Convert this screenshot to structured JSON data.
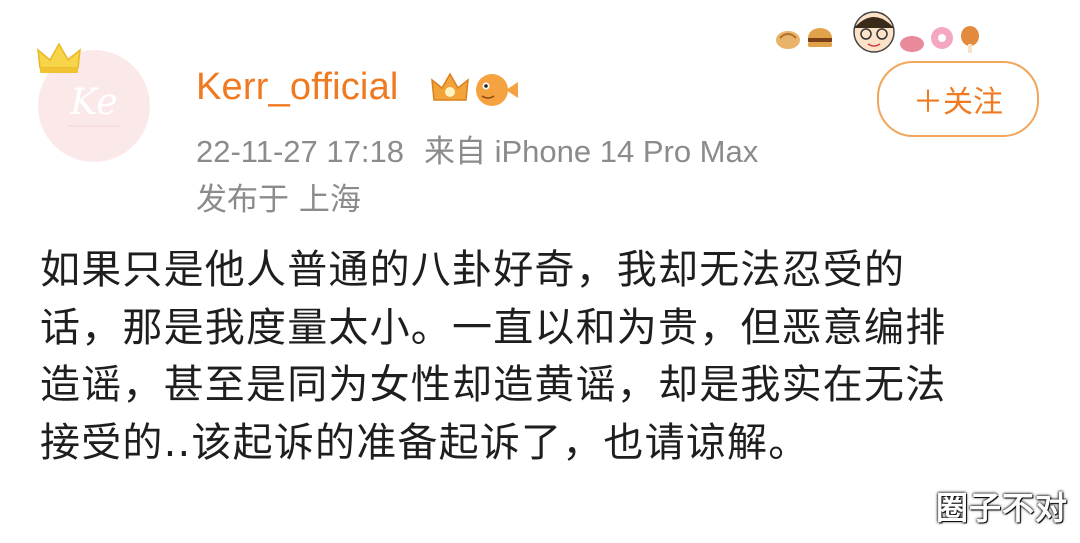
{
  "header": {
    "username": "Kerr_official",
    "follow_label": "＋关注",
    "time": "22-11-27 17:18",
    "source": "来自 iPhone 14 Pro Max",
    "location": "发布于 上海"
  },
  "avatar": {
    "monogram": "Ke"
  },
  "post": {
    "lines": [
      "如果只是他人普通的八卦好奇，我却无法忍受的",
      "话，那是我度量太小。一直以和为贵，但恶意编排",
      "造谣，甚至是同为女性却造黄谣，却是我实在无法",
      "接受的..该起诉的准备起诉了，也请谅解。"
    ]
  },
  "watermark": "圈子不对",
  "colors": {
    "accent": "#f07a22",
    "follow_border": "#f2a65a",
    "meta": "#8b8b8b",
    "text": "#1e1e1e"
  },
  "icons": [
    "crown-icon",
    "vip-crown-icon",
    "pufferfish-icon",
    "bread-icon",
    "burger-icon",
    "cartoon-face-icon",
    "donut-icon",
    "drumstick-icon"
  ]
}
